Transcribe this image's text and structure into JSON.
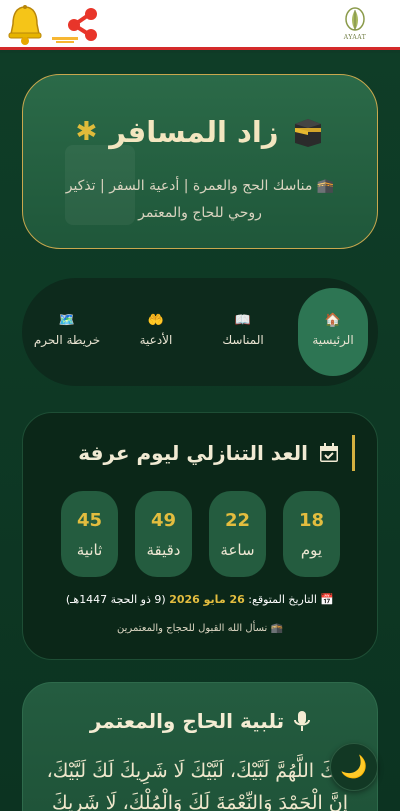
{
  "header": {
    "logo_text": "AYAAT"
  },
  "hero": {
    "title": "زاد المسافر",
    "subtitle": "🕋 مناسك الحج والعمرة | أدعية السفر | تذكير روحي للحاج والمعتمر"
  },
  "nav": {
    "items": [
      {
        "icon": "🏠",
        "label": "الرئيسية"
      },
      {
        "icon": "📖",
        "label": "المناسك"
      },
      {
        "icon": "🤲",
        "label": "الأدعية"
      },
      {
        "icon": "🗺️",
        "label": "خريطة الحرم"
      }
    ]
  },
  "countdown": {
    "title": "العد التنازلي ليوم عرفة",
    "days": {
      "value": "18",
      "label": "يوم"
    },
    "hours": {
      "value": "22",
      "label": "ساعة"
    },
    "minutes": {
      "value": "49",
      "label": "دقيقة"
    },
    "seconds": {
      "value": "45",
      "label": "ثانية"
    },
    "date_prefix": "📅 التاريخ المتوقع:",
    "date_value": "26 مايو 2026",
    "date_suffix": "(9 ذو الحجة 1447هـ)",
    "prayer": "🕋 نسأل الله القبول للحجاج والمعتمرين"
  },
  "talbiyah": {
    "title": "تلبية الحاج والمعتمر",
    "text": "لَبَّيْكَ اللَّهُمَّ لَبَّيْكَ، لَبَّيْكَ لَا شَرِيكَ لَكَ لَبَّيْكَ، إِنَّ الْحَمْدَ وَالنِّعْمَةَ لَكَ وَالْمُلْكَ، لَا شَرِيكَ لَكَ"
  },
  "colors": {
    "accent_gold": "#e3bd3f",
    "header_border": "#d42a2a",
    "background": "#0f3a26"
  }
}
